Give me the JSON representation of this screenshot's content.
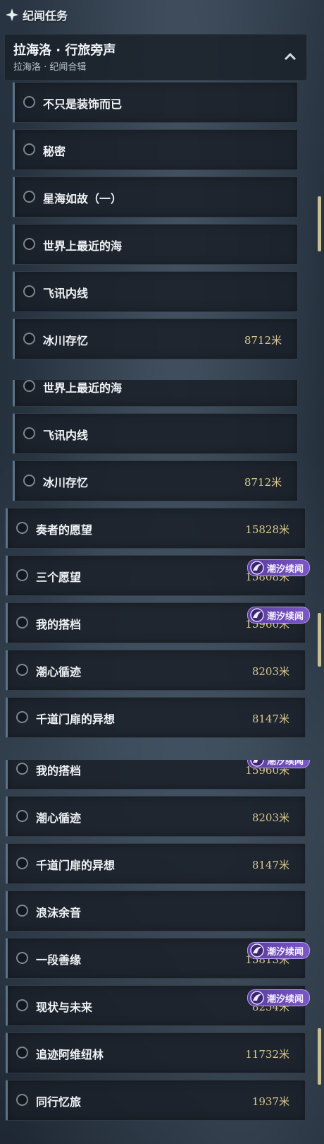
{
  "header": {
    "section_title": "纪闻任务"
  },
  "group": {
    "title": "拉海洛 · 行旅旁声",
    "subtitle": "拉海洛 · 纪闻合辑"
  },
  "badge_label": "潮汐续闻",
  "segment1": {
    "rows": [
      {
        "label": "不只是装饰而已",
        "distance": ""
      },
      {
        "label": "秘密",
        "distance": ""
      },
      {
        "label": "星海如故（一）",
        "distance": ""
      },
      {
        "label": "世界上最近的海",
        "distance": ""
      },
      {
        "label": "飞讯内线",
        "distance": ""
      },
      {
        "label": "冰川存忆",
        "distance": "8712米"
      }
    ]
  },
  "segment2": {
    "rows": [
      {
        "label": "世界上最近的海",
        "distance": ""
      },
      {
        "label": "飞讯内线",
        "distance": ""
      },
      {
        "label": "冰川存忆",
        "distance": "8712米"
      },
      {
        "label": "奏者的愿望",
        "distance": "15828米"
      },
      {
        "label": "三个愿望",
        "distance": "15808米",
        "badge": true
      },
      {
        "label": "我的搭档",
        "distance": "15960米",
        "badge": true
      },
      {
        "label": "潮心循迹",
        "distance": "8203米"
      },
      {
        "label": "千道门扉的异想",
        "distance": "8147米"
      }
    ]
  },
  "segment3": {
    "rows": [
      {
        "label": "我的搭档",
        "distance": "15960米"
      },
      {
        "label": "潮心循迹",
        "distance": "8203米"
      },
      {
        "label": "千道门扉的异想",
        "distance": "8147米"
      },
      {
        "label": "浪沫余音",
        "distance": ""
      },
      {
        "label": "一段善缘",
        "distance": "15813米",
        "badge": true
      },
      {
        "label": "现状与未来",
        "distance": "8254米",
        "badge": true
      },
      {
        "label": "追迹阿维纽林",
        "distance": "11732米"
      },
      {
        "label": "同行忆旅",
        "distance": "1937米"
      }
    ]
  },
  "colors": {
    "accent_gold": "#d9c791",
    "badge_purple": "#7b57c7",
    "row_bg": "#1a2028"
  },
  "icons": {
    "section": "four-point-star-icon",
    "collapse": "chevron-up-icon",
    "badge": "tide-sprite-icon",
    "row": "radio-circle-icon"
  }
}
